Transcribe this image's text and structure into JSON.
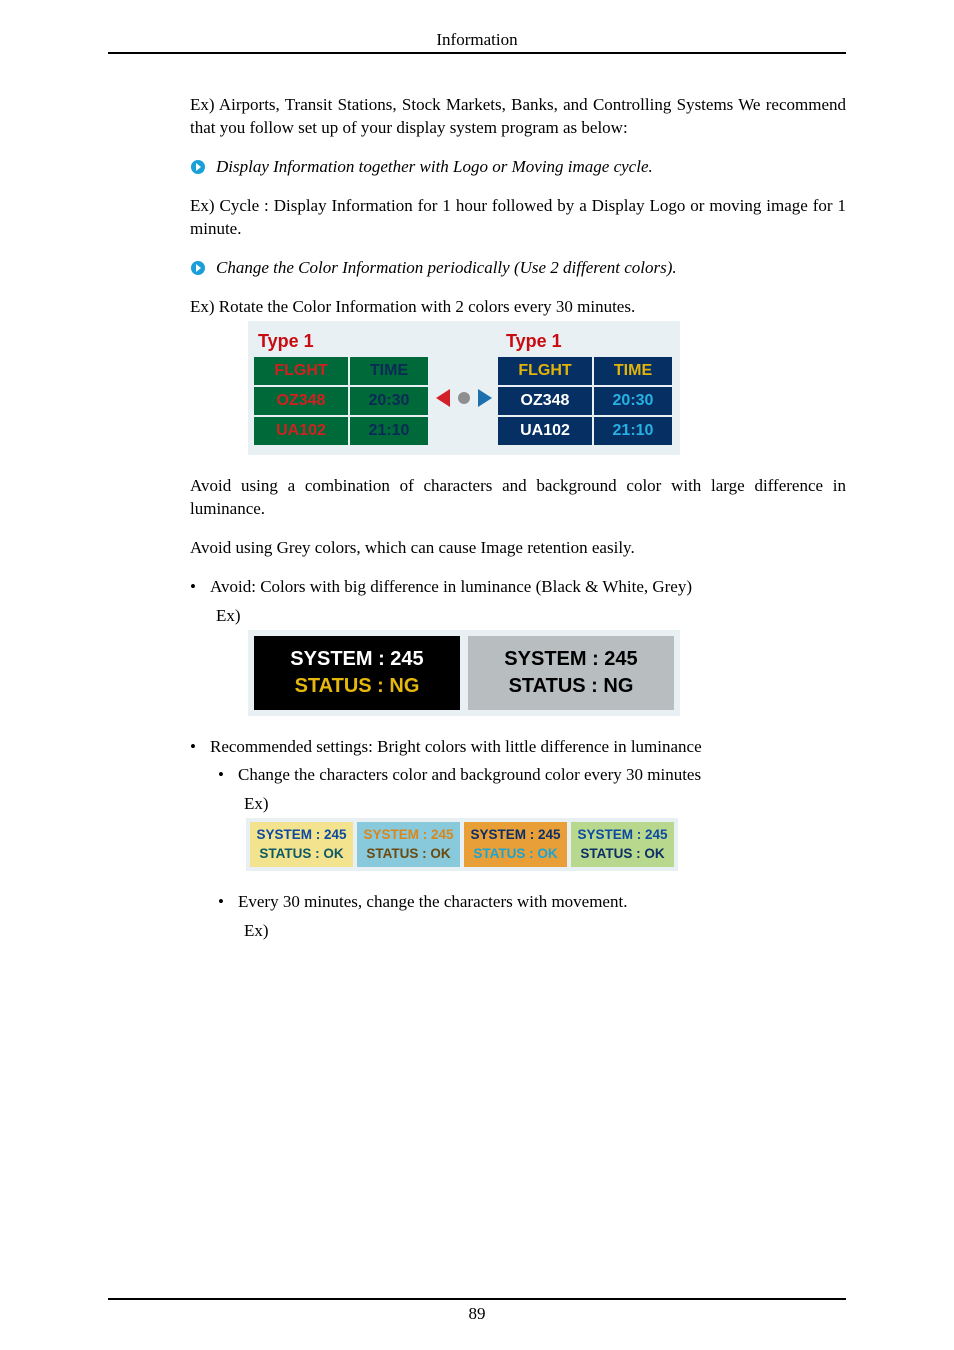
{
  "header": {
    "title": "Information"
  },
  "footer": {
    "page_number": "89"
  },
  "text": {
    "p1": "Ex) Airports, Transit Stations, Stock Markets, Banks, and Controlling Systems We recommend that you follow set up of your display system program as below:",
    "arrow1": "Display Information together with Logo or Moving image cycle.",
    "p2": "Ex) Cycle : Display Information for 1 hour followed by a Display Logo or moving image for 1 minute.",
    "arrow2": "Change the Color Information periodically (Use 2 different colors).",
    "p3": "Ex) Rotate the Color Information with 2 colors every 30 minutes.",
    "p4": "Avoid using a combination of characters and background color with large difference in luminance.",
    "p5": "Avoid using Grey colors, which can cause Image retention easily.",
    "b1": "Avoid: Colors with big difference in luminance (Black & White, Grey)",
    "b2": "Recommended settings: Bright colors with little difference in luminance",
    "b2a": "Change the characters color and background color every 30 minutes",
    "b2b": "Every 30 minutes, change the characters with movement.",
    "ex": "Ex)"
  },
  "fig1": {
    "type_label": "Type 1",
    "headers": {
      "c1": "FLGHT",
      "c2": "TIME"
    },
    "rows": [
      {
        "c1": "OZ348",
        "c2": "20:30"
      },
      {
        "c1": "UA102",
        "c2": "21:10"
      }
    ]
  },
  "fig2": {
    "line1": "SYSTEM : 245",
    "line2": "STATUS : NG"
  },
  "fig3": {
    "line1": "SYSTEM : 245",
    "line2": "STATUS : OK"
  }
}
